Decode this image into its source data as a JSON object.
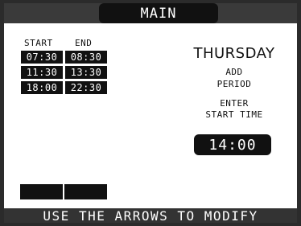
{
  "title": "MAIN",
  "schedule": {
    "start_label": "START",
    "end_label": "END",
    "rows": [
      {
        "start": "07:30",
        "end": "08:30"
      },
      {
        "start": "11:30",
        "end": "13:30"
      },
      {
        "start": "18:00",
        "end": "22:30"
      }
    ]
  },
  "panel": {
    "day": "THURSDAY",
    "action_line1": "ADD",
    "action_line2": "PERIOD",
    "prompt_line1": "ENTER",
    "prompt_line2": "START TIME",
    "time_value": "14:00"
  },
  "footer": "USE THE ARROWS TO MODIFY",
  "colors": {
    "background": "#ffffff",
    "cell": "#111111",
    "title_bar": "#3a3a3a",
    "footer_bar": "#333333",
    "text_inverse": "#ffffff"
  }
}
